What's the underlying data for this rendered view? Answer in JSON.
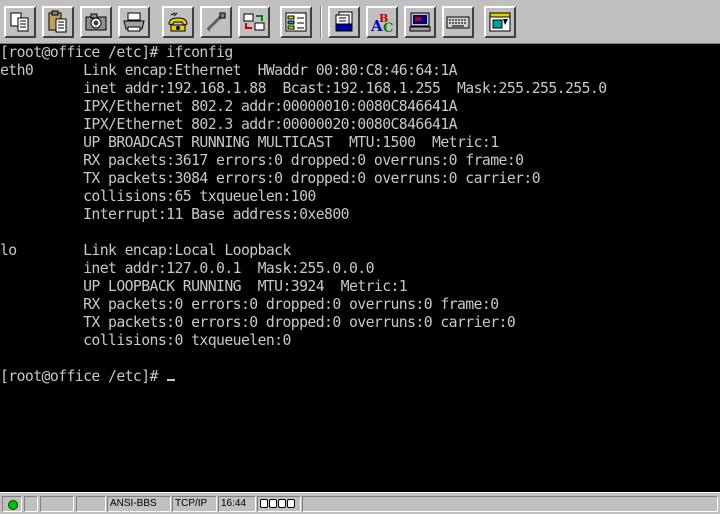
{
  "toolbar": {
    "buttons": [
      {
        "name": "copy-icon"
      },
      {
        "name": "paste-icon"
      },
      {
        "name": "camera-icon"
      },
      {
        "name": "print-icon"
      },
      {
        "name": "dial-phone-icon"
      },
      {
        "name": "hangup-icon"
      },
      {
        "name": "transfer-icon"
      },
      {
        "name": "settings-icon"
      },
      {
        "name": "batch-icon"
      },
      {
        "name": "abc-spell-icon"
      },
      {
        "name": "terminal-icon"
      },
      {
        "name": "keyboard-icon"
      },
      {
        "name": "close-window-icon"
      }
    ]
  },
  "terminal": {
    "lines": [
      "[root@office /etc]# ifconfig",
      "eth0      Link encap:Ethernet  HWaddr 00:80:C8:46:64:1A",
      "          inet addr:192.168.1.88  Bcast:192.168.1.255  Mask:255.255.255.0",
      "          IPX/Ethernet 802.2 addr:00000010:0080C846641A",
      "          IPX/Ethernet 802.3 addr:00000020:0080C846641A",
      "          UP BROADCAST RUNNING MULTICAST  MTU:1500  Metric:1",
      "          RX packets:3617 errors:0 dropped:0 overruns:0 frame:0",
      "          TX packets:3084 errors:0 dropped:0 overruns:0 carrier:0",
      "          collisions:65 txqueuelen:100",
      "          Interrupt:11 Base address:0xe800",
      "",
      "lo        Link encap:Local Loopback",
      "          inet addr:127.0.0.1  Mask:255.0.0.0",
      "          UP LOOPBACK RUNNING  MTU:3924  Metric:1",
      "          RX packets:0 errors:0 dropped:0 overruns:0 frame:0",
      "          TX packets:0 errors:0 dropped:0 overruns:0 carrier:0",
      "          collisions:0 txqueuelen:0",
      "",
      "[root@office /etc]# "
    ],
    "foreground": "#c8c8c8",
    "background": "#000000"
  },
  "statusbar": {
    "status_led_color": "#00c000",
    "emulation": "ANSI-BBS",
    "protocol": "TCP/IP",
    "time": "16:44"
  }
}
